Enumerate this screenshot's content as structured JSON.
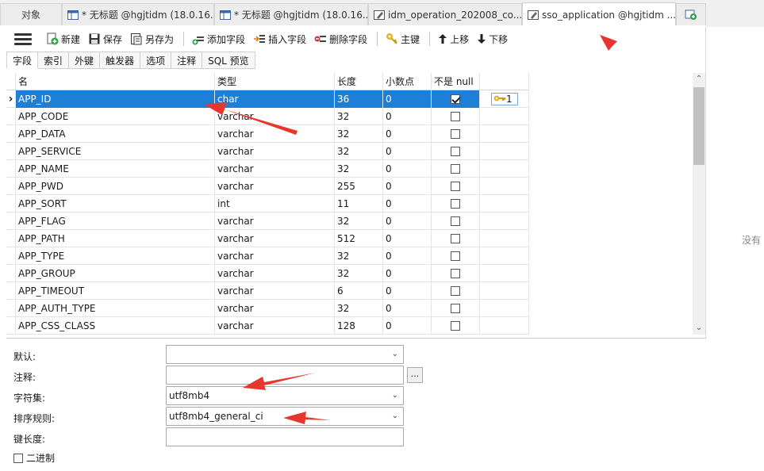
{
  "tabs": [
    {
      "label": "对象"
    },
    {
      "label": "* 无标题 @hgjtidm (18.0.16..."
    },
    {
      "label": "* 无标题 @hgjtidm (18.0.16..."
    },
    {
      "label": "idm_operation_202008_co..."
    },
    {
      "label": "sso_application @hgjtidm ..."
    }
  ],
  "toolbar": {
    "new": "新建",
    "save": "保存",
    "save_as": "另存为",
    "add_field": "添加字段",
    "insert_field": "插入字段",
    "delete_field": "删除字段",
    "primary_key": "主键",
    "move_up": "上移",
    "move_down": "下移"
  },
  "subtabs": [
    "字段",
    "索引",
    "外键",
    "触发器",
    "选项",
    "注释",
    "SQL 预览"
  ],
  "grid": {
    "headers": {
      "name": "名",
      "type": "类型",
      "length": "长度",
      "decimals": "小数点",
      "not_null": "不是 null"
    },
    "rows": [
      {
        "name": "APP_ID",
        "type": "char",
        "length": "36",
        "decimals": "0",
        "not_null": true,
        "key": "1",
        "selected": true
      },
      {
        "name": "APP_CODE",
        "type": "varchar",
        "length": "32",
        "decimals": "0",
        "not_null": false
      },
      {
        "name": "APP_DATA",
        "type": "varchar",
        "length": "32",
        "decimals": "0",
        "not_null": false
      },
      {
        "name": "APP_SERVICE",
        "type": "varchar",
        "length": "32",
        "decimals": "0",
        "not_null": false
      },
      {
        "name": "APP_NAME",
        "type": "varchar",
        "length": "32",
        "decimals": "0",
        "not_null": false
      },
      {
        "name": "APP_PWD",
        "type": "varchar",
        "length": "255",
        "decimals": "0",
        "not_null": false
      },
      {
        "name": "APP_SORT",
        "type": "int",
        "length": "11",
        "decimals": "0",
        "not_null": false
      },
      {
        "name": "APP_FLAG",
        "type": "varchar",
        "length": "32",
        "decimals": "0",
        "not_null": false
      },
      {
        "name": "APP_PATH",
        "type": "varchar",
        "length": "512",
        "decimals": "0",
        "not_null": false
      },
      {
        "name": "APP_TYPE",
        "type": "varchar",
        "length": "32",
        "decimals": "0",
        "not_null": false
      },
      {
        "name": "APP_GROUP",
        "type": "varchar",
        "length": "32",
        "decimals": "0",
        "not_null": false
      },
      {
        "name": "APP_TIMEOUT",
        "type": "varchar",
        "length": "6",
        "decimals": "0",
        "not_null": false
      },
      {
        "name": "APP_AUTH_TYPE",
        "type": "varchar",
        "length": "32",
        "decimals": "0",
        "not_null": false
      },
      {
        "name": "APP_CSS_CLASS",
        "type": "varchar",
        "length": "128",
        "decimals": "0",
        "not_null": false
      }
    ]
  },
  "props": {
    "default_label": "默认:",
    "comment_label": "注释:",
    "charset_label": "字符集:",
    "charset_value": "utf8mb4",
    "collation_label": "排序规则:",
    "collation_value": "utf8mb4_general_ci",
    "key_length_label": "键长度:",
    "binary_label": "二进制",
    "ellipsis": "..."
  },
  "side_text": "没有",
  "colors": {
    "selection": "#1e7fd6",
    "annotation": "#e8352e"
  }
}
